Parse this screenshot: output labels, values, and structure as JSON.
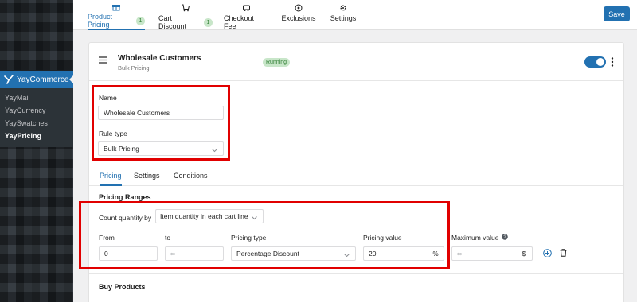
{
  "sidebar": {
    "plugin_name": "YayCommerce",
    "items": [
      {
        "label": "YayMail",
        "current": false
      },
      {
        "label": "YayCurrency",
        "current": false
      },
      {
        "label": "YaySwatches",
        "current": false
      },
      {
        "label": "YayPricing",
        "current": true
      }
    ]
  },
  "topbar": {
    "tabs": [
      {
        "label": "Product Pricing",
        "badge": "1",
        "icon": "gift-icon",
        "active": true
      },
      {
        "label": "Cart Discount",
        "badge": "1",
        "icon": "cart-icon",
        "active": false
      },
      {
        "label": "Checkout Fee",
        "icon": "truck-icon",
        "active": false
      },
      {
        "label": "Exclusions",
        "icon": "circle-plus-icon",
        "active": false
      },
      {
        "label": "Settings",
        "icon": "gear-icon",
        "active": false
      }
    ],
    "save_label": "Save"
  },
  "rule": {
    "title": "Wholesale Customers",
    "subtitle": "Bulk Pricing",
    "status": "Running",
    "enabled": true
  },
  "form": {
    "name_label": "Name",
    "name_value": "Wholesale Customers",
    "rule_type_label": "Rule type",
    "rule_type_value": "Bulk Pricing"
  },
  "subtabs": [
    {
      "label": "Pricing",
      "active": true
    },
    {
      "label": "Settings",
      "active": false
    },
    {
      "label": "Conditions",
      "active": false
    }
  ],
  "pricing_ranges": {
    "title": "Pricing Ranges",
    "count_label": "Count quantity by",
    "count_value": "Item quantity in each cart line",
    "columns": {
      "from": "From",
      "to": "to",
      "pricing_type": "Pricing type",
      "pricing_value": "Pricing value",
      "maximum_value": "Maximum value"
    },
    "row": {
      "from": "0",
      "to_placeholder": "∞",
      "pricing_type": "Percentage Discount",
      "pricing_value": "20",
      "pricing_value_unit": "%",
      "max_placeholder": "∞",
      "max_unit": "$"
    }
  },
  "buy_products": {
    "title": "Buy Products"
  },
  "colors": {
    "accent": "#2271b1",
    "highlight_box": "#e10000",
    "status_bg": "#c8e6c9"
  }
}
